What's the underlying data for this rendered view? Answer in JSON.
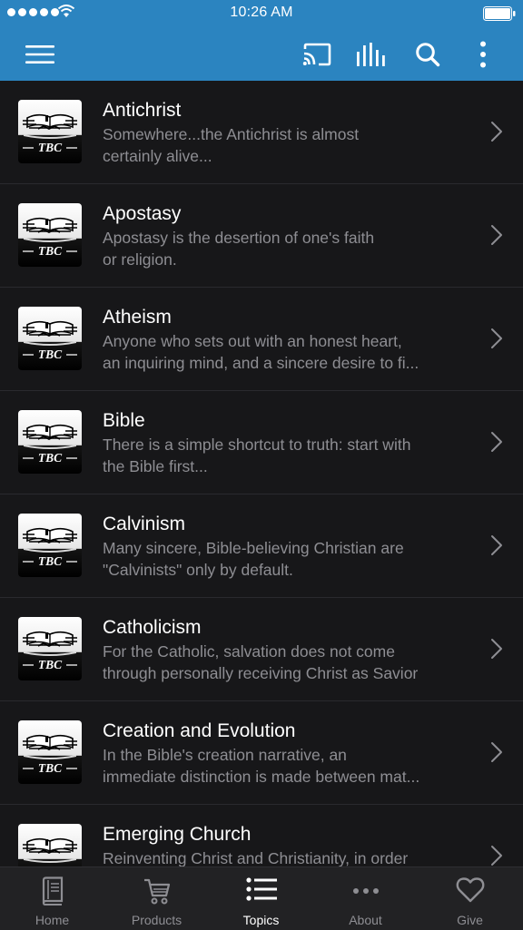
{
  "status_bar": {
    "time": "10:26 AM"
  },
  "topics": [
    {
      "title": "Antichrist",
      "desc_line1": "Somewhere...the Antichrist is almost",
      "desc_line2": "certainly alive..."
    },
    {
      "title": "Apostasy",
      "desc_line1": "Apostasy is the desertion of one's faith",
      "desc_line2": "or religion."
    },
    {
      "title": "Atheism",
      "desc_line1": "Anyone who sets out with an honest heart,",
      "desc_line2": "an inquiring mind, and a sincere desire to fi..."
    },
    {
      "title": "Bible",
      "desc_line1": "There is a simple shortcut to truth: start with",
      "desc_line2": "the Bible first..."
    },
    {
      "title": "Calvinism",
      "desc_line1": "Many sincere, Bible-believing Christian are",
      "desc_line2": "\"Calvinists\" only by default."
    },
    {
      "title": "Catholicism",
      "desc_line1": "For the Catholic, salvation does not come",
      "desc_line2": "through personally receiving Christ as Savior"
    },
    {
      "title": "Creation and Evolution",
      "desc_line1": "In the Bible's creation narrative, an",
      "desc_line2": "immediate distinction is made between mat..."
    },
    {
      "title": "Emerging Church",
      "desc_line1": "Reinventing Christ and Christianity, in order",
      "desc_line2": ""
    }
  ],
  "thumb_label": "TBC",
  "tabs": {
    "home": "Home",
    "products": "Products",
    "topics": "Topics",
    "about": "About",
    "give": "Give"
  },
  "colors": {
    "header": "#2b84c0",
    "background": "#171719",
    "tabbar": "#222224",
    "active_tab": "#ffffff",
    "inactive_tab": "#8e8e93"
  }
}
